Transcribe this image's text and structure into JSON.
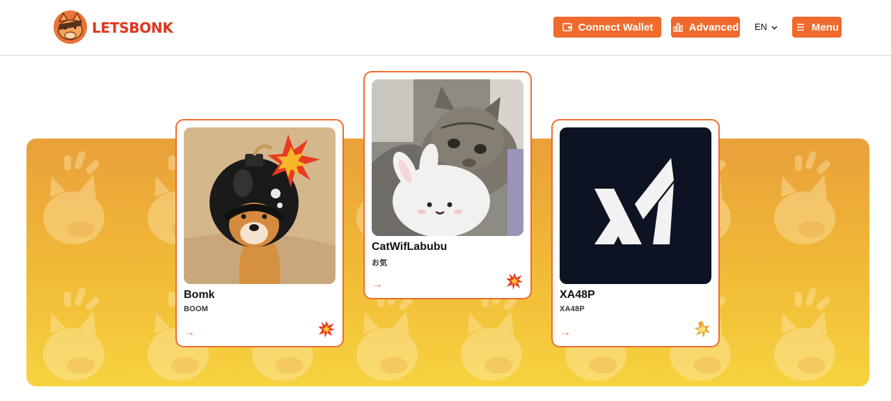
{
  "brand": {
    "name": "LETSBONK",
    "accent": "#ef6a2c",
    "brand_red": "#e2341d"
  },
  "header": {
    "connect_label": "Connect Wallet",
    "advanced_label": "Advanced",
    "lang": "EN",
    "menu_label": "Menu"
  },
  "cards": [
    {
      "name": "Bomk",
      "ticker": "BOOM",
      "badge_icon": "explosion-icon"
    },
    {
      "name": "CatWifLabubu",
      "ticker": "お気",
      "badge_icon": "explosion-icon"
    },
    {
      "name": "XA48P",
      "ticker": "XA48P",
      "badge_icon": "star-burst-icon"
    }
  ]
}
